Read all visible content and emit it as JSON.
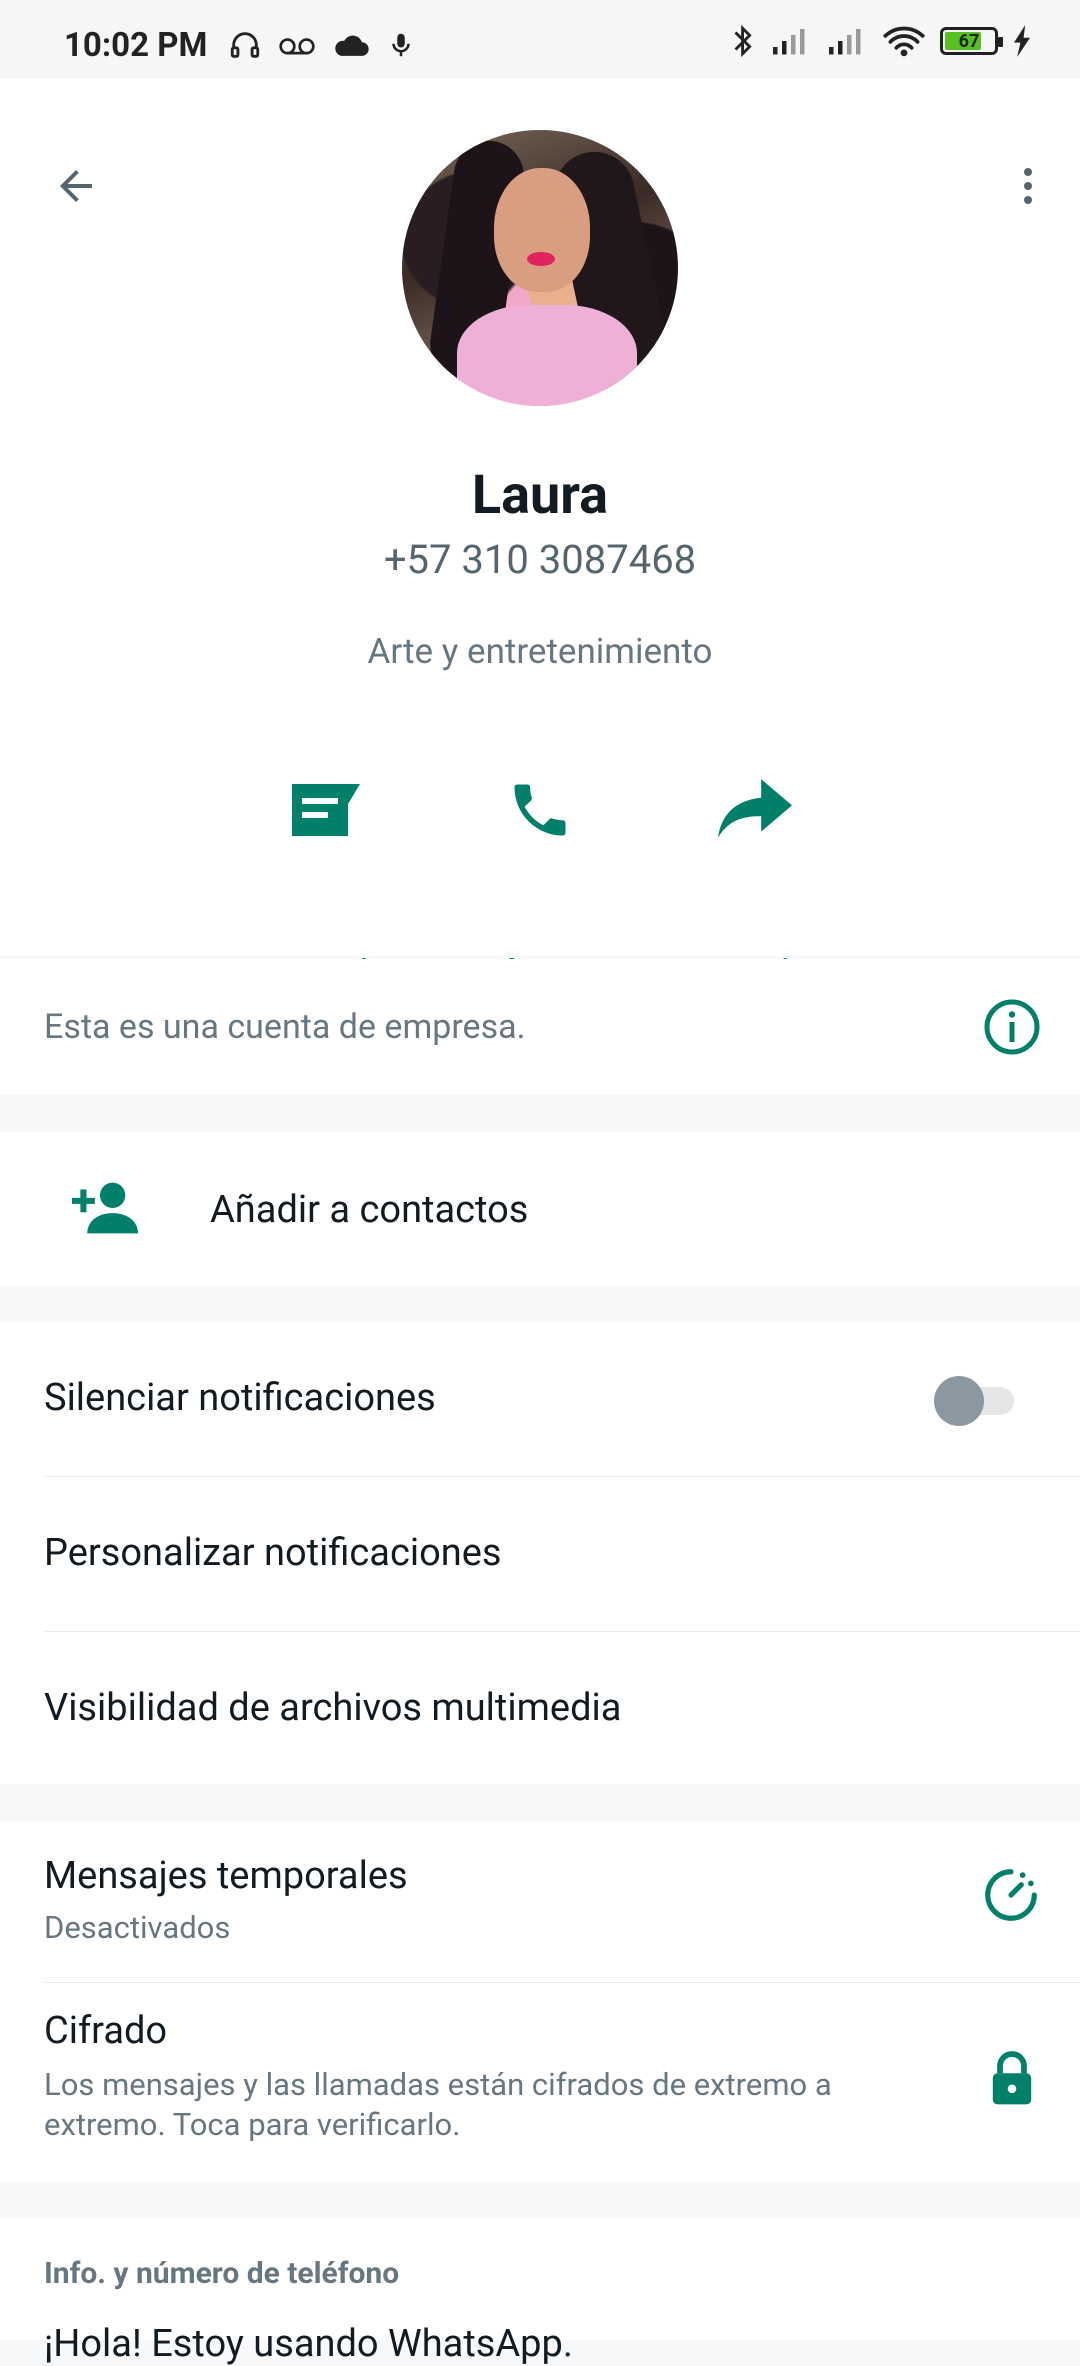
{
  "status_bar": {
    "time": "10:02 PM",
    "battery": "67"
  },
  "header": {
    "back_icon": "arrow-left-icon",
    "more_icon": "more-vert-icon"
  },
  "contact": {
    "name": "Laura",
    "phone": "+57 310 3087468",
    "category": "Arte y entretenimiento"
  },
  "actions": [
    {
      "label": "Mensaje",
      "icon": "message-icon"
    },
    {
      "label": "Llamar",
      "icon": "phone-icon"
    },
    {
      "label": "Reenviar",
      "icon": "share-icon"
    }
  ],
  "business": {
    "text": "Esta es una cuenta de empresa."
  },
  "add_contact": {
    "label": "Añadir a contactos"
  },
  "notifications": {
    "mute_label": "Silenciar notificaciones",
    "customize_label": "Personalizar notificaciones",
    "media_label": "Visibilidad de archivos multimedia",
    "mute_enabled": false
  },
  "security": {
    "temp_title": "Mensajes temporales",
    "temp_sub": "Desactivados",
    "enc_title": "Cifrado",
    "enc_sub": "Los mensajes y las llamadas están cifrados de extremo a extremo. Toca para verificarlo."
  },
  "about": {
    "heading": "Info. y número de teléfono",
    "value": "¡Hola! Estoy usando WhatsApp."
  },
  "colors": {
    "accent": "#008069",
    "text_primary": "#111b21",
    "text_secondary": "#667781"
  }
}
